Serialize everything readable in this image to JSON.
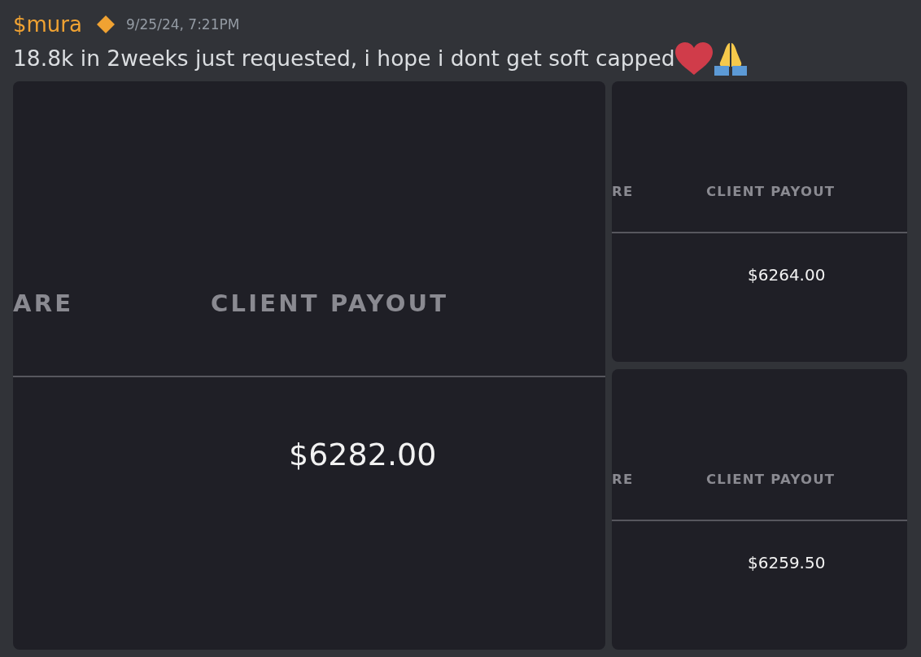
{
  "message": {
    "username": "$mura",
    "timestamp": "9/25/24, 7:21PM",
    "text": "18.8k in 2weeks just requested, i hope i dont get soft capped"
  },
  "attachments": [
    {
      "cells": [
        {
          "header": "ARE"
        },
        {
          "header": "CLIENT PAYOUT",
          "value": "$6282.00"
        }
      ]
    },
    {
      "cells": [
        {
          "header": "RE"
        },
        {
          "header": "CLIENT PAYOUT",
          "value": "$6264.00"
        }
      ]
    },
    {
      "cells": [
        {
          "header": "RE"
        },
        {
          "header": "CLIENT PAYOUT",
          "value": "$6259.50"
        }
      ]
    }
  ]
}
